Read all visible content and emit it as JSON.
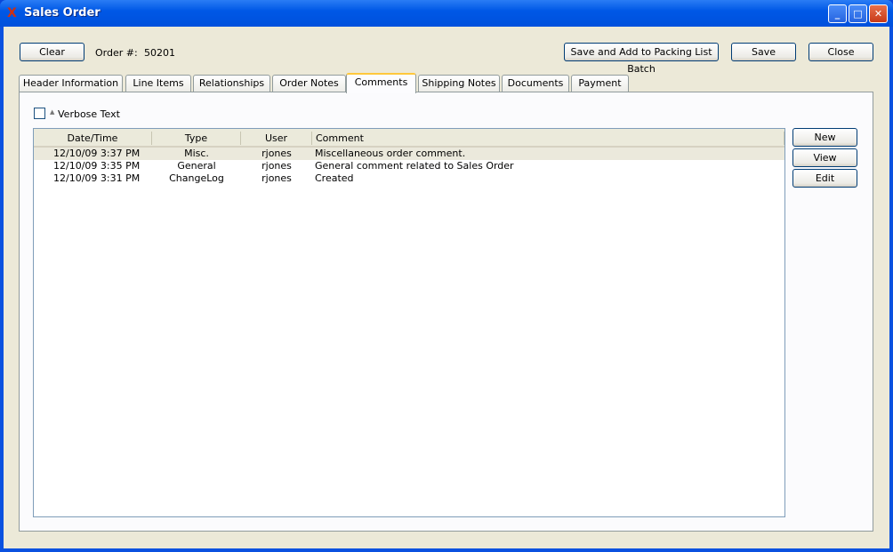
{
  "window": {
    "title": "Sales Order",
    "minimize": "_",
    "maximize": "□",
    "close": "✕"
  },
  "toolbar": {
    "clear": "Clear",
    "order_label": "Order #:",
    "order_number": "50201",
    "save_add": "Save and Add to Packing List Batch",
    "save": "Save",
    "close": "Close"
  },
  "tabs": [
    {
      "label": "Header Information"
    },
    {
      "label": "Line Items"
    },
    {
      "label": "Relationships"
    },
    {
      "label": "Order Notes"
    },
    {
      "label": "Comments"
    },
    {
      "label": "Shipping Notes"
    },
    {
      "label": "Documents"
    },
    {
      "label": "Payment"
    }
  ],
  "comments": {
    "verbose_label": "Verbose Text",
    "verbose_checked": false,
    "columns": [
      "Date/Time",
      "Type",
      "User",
      "Comment"
    ],
    "rows": [
      {
        "datetime": "12/10/09 3:37 PM",
        "type": "Misc.",
        "user": "rjones",
        "comment": "Miscellaneous order comment."
      },
      {
        "datetime": "12/10/09 3:35 PM",
        "type": "General",
        "user": "rjones",
        "comment": "General comment related to Sales Order"
      },
      {
        "datetime": "12/10/09 3:31 PM",
        "type": "ChangeLog",
        "user": "rjones",
        "comment": "Created"
      }
    ],
    "buttons": {
      "new": "New",
      "view": "View",
      "edit": "Edit"
    }
  }
}
